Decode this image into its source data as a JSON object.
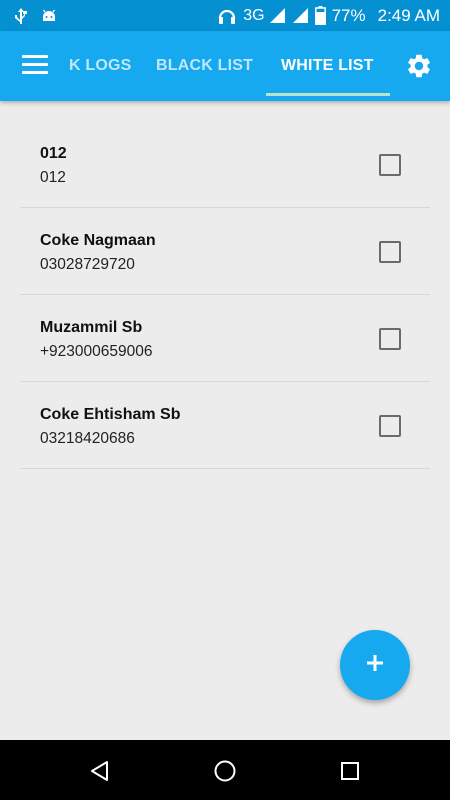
{
  "status_bar": {
    "network": "3G",
    "battery": "77%",
    "time": "2:49 AM",
    "icons": [
      "usb-icon",
      "android-debug-icon",
      "headset-icon",
      "signal-icon",
      "signal-icon",
      "battery-icon"
    ]
  },
  "app_bar": {
    "menu_icon": "hamburger-icon",
    "settings_icon": "gear-icon",
    "tabs": [
      {
        "label": "K LOGS",
        "active": false
      },
      {
        "label": "BLACK LIST",
        "active": false
      },
      {
        "label": "WHITE LIST",
        "active": true
      }
    ]
  },
  "contacts": [
    {
      "name": "012",
      "number": "012",
      "checked": false
    },
    {
      "name": "Coke Nagmaan",
      "number": "03028729720",
      "checked": false
    },
    {
      "name": "Muzammil Sb",
      "number": "+923000659006",
      "checked": false
    },
    {
      "name": "Coke Ehtisham Sb",
      "number": "03218420686",
      "checked": false
    }
  ],
  "fab": {
    "icon": "plus-icon"
  },
  "nav_bar": {
    "icons": [
      "back-icon",
      "home-icon",
      "recents-icon"
    ]
  },
  "colors": {
    "status_bar": "#0590d2",
    "app_bar": "#16a9f0",
    "tab_indicator": "#b5e4c7",
    "background": "#ececec"
  }
}
